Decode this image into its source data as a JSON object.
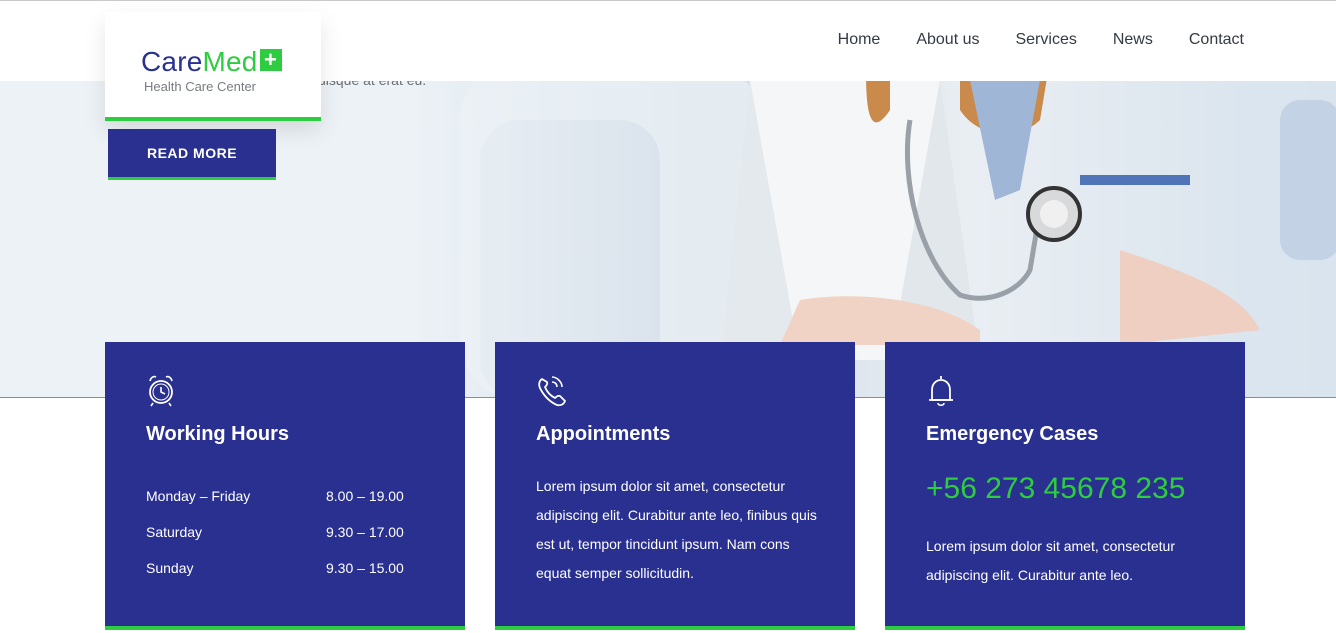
{
  "hero": {
    "partial_text": "uisque at erat eu.",
    "read_more_label": "READ MORE"
  },
  "logo": {
    "care": "Care",
    "med": "Med",
    "plus": "+",
    "subtitle": "Health Care Center"
  },
  "nav": {
    "items": [
      "Home",
      "About us",
      "Services",
      "News",
      "Contact"
    ]
  },
  "cards": {
    "working_hours": {
      "icon": "alarm-clock-icon",
      "title": "Working Hours",
      "rows": [
        {
          "day": "Monday – Friday",
          "time": "8.00 – 19.00"
        },
        {
          "day": "Saturday",
          "time": "9.30 – 17.00"
        },
        {
          "day": "Sunday",
          "time": "9.30 – 15.00"
        }
      ]
    },
    "appointments": {
      "icon": "phone-call-icon",
      "title": "Appointments",
      "text": "Lorem ipsum dolor sit amet, consectetur adipiscing elit. Curabitur ante leo, finibus quis est ut, tempor tincidunt ipsum. Nam cons equat semper sollicitudin."
    },
    "emergency": {
      "icon": "bell-icon",
      "title": "Emergency Cases",
      "phone": "+56 273 45678 235",
      "text": "Lorem ipsum dolor sit amet, consectetur adipiscing elit. Curabitur ante leo."
    }
  },
  "colors": {
    "brand_blue": "#29308f",
    "brand_green": "#2ecc40"
  }
}
